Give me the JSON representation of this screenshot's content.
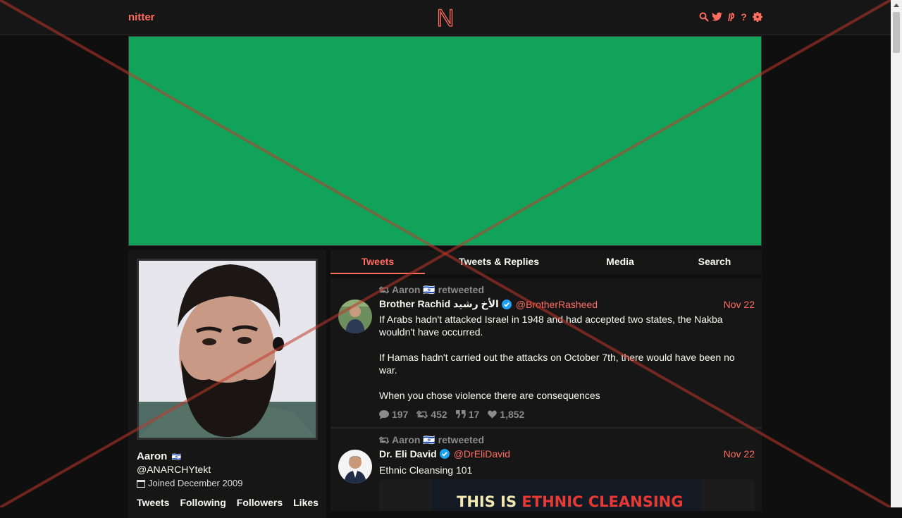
{
  "nav": {
    "brand": "nitter",
    "logo_letter": "N",
    "icons": [
      "search-icon",
      "twitter-icon",
      "rss-icon",
      "help-icon",
      "gear-icon"
    ]
  },
  "profile": {
    "name": "Aaron",
    "flag": "🇮🇱",
    "handle": "@ANARCHYtekt",
    "joined": "Joined December 2009",
    "stats": [
      "Tweets",
      "Following",
      "Followers",
      "Likes"
    ]
  },
  "tabs": [
    "Tweets",
    "Tweets & Replies",
    "Media",
    "Search"
  ],
  "tweets": [
    {
      "retweet_by": "Aaron 🇮🇱 retweeted",
      "fullname": "Brother Rachid الأخ رشيد",
      "verified": true,
      "handle": "@BrotherRasheed",
      "date": "Nov 22",
      "body": [
        "If Arabs hadn't attacked Israel in 1948 and had accepted two states, the Nakba wouldn't have occurred.",
        "If Hamas hadn't carried out the attacks on October 7th, there would have been no war.",
        "When you chose violence there are consequences"
      ],
      "stats": {
        "replies": "197",
        "retweets": "452",
        "quotes": "17",
        "likes": "1,852"
      }
    },
    {
      "retweet_by": "Aaron 🇮🇱 retweeted",
      "fullname": "Dr. Eli David",
      "verified": true,
      "handle": "@DrEliDavid",
      "date": "Nov 22",
      "body": [
        "Ethnic Cleansing 101"
      ],
      "media_text": {
        "part1": "THIS IS ",
        "part2": "ETHNIC CLEANSING"
      }
    }
  ],
  "colors": {
    "accent": "#ff6c60",
    "banner": "#12a35a",
    "background": "#0f0f0f",
    "panel": "#161616",
    "verified": "#1da1f2",
    "overlay_x": "#c0392b"
  }
}
